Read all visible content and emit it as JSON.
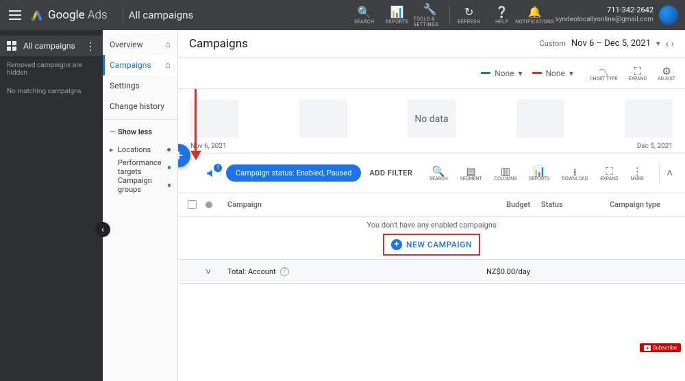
{
  "header": {
    "app_name_strong": "Google",
    "app_name_light": "Ads",
    "scope": "All campaigns",
    "tools": {
      "search": "SEARCH",
      "reports": "REPORTS",
      "tools": "TOOLS & SETTINGS",
      "refresh": "REFRESH",
      "help": "HELP",
      "notifications": "NOTIFICATIONS"
    },
    "account_id": "711-342-2642",
    "account_email": "syndeolocallyonline@gmail.com"
  },
  "left_rail": {
    "main_item": "All campaigns",
    "note1": "Removed campaigns are hidden",
    "note2": "No matching campaigns"
  },
  "mid_nav": {
    "overview": "Overview",
    "campaigns": "Campaigns",
    "settings": "Settings",
    "change_history": "Change history",
    "show_less": "Show less",
    "locations": "Locations",
    "performance_targets": "Performance targets",
    "campaign_groups": "Campaign groups"
  },
  "content": {
    "title": "Campaigns",
    "date_prefix": "Custom",
    "date_range": "Nov 6 – Dec 5, 2021",
    "metric_none": "None",
    "view_tools": {
      "chart_type": "CHART TYPE",
      "expand": "EXPAND",
      "adjust": "ADJUST"
    },
    "chart_nodata": "No data",
    "chart_start": "Nov 6, 2021",
    "chart_end": "Dec 5, 2021",
    "status_pill": "Campaign status: Enabled, Paused",
    "add_filter": "ADD FILTER",
    "announce_count": "1",
    "toolbar": {
      "search": "SEARCH",
      "segment": "SEGMENT",
      "columns": "COLUMNS",
      "reports": "REPORTS",
      "download": "DOWNLOAD",
      "expand": "EXPAND",
      "more": "MORE"
    },
    "columns": {
      "campaign": "Campaign",
      "budget": "Budget",
      "status": "Status",
      "type": "Campaign type"
    },
    "empty_msg": "You don't have any enabled campaigns",
    "new_campaign": "NEW CAMPAIGN",
    "total_label": "Total: Account",
    "total_budget": "NZ$0.00/day"
  },
  "overlay": {
    "subscribe": "Subscribe"
  }
}
